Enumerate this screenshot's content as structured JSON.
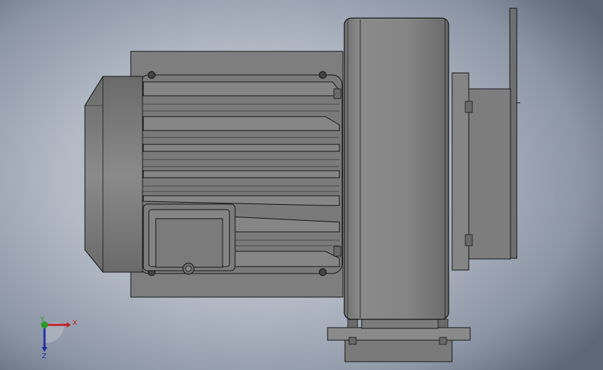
{
  "colors": {
    "background_center": "#c9ced8",
    "background_edge": "#5e6778",
    "part_shade": "#7a7a7a",
    "part_light": "#8c8c8c",
    "edge_line": "#111111",
    "x_axis": "#c0202a",
    "y_axis": "#2a9a2a",
    "z_axis": "#1f2fa8"
  },
  "triad": {
    "x_label": "X",
    "y_label": "Y",
    "z_label": "Z",
    "icon": "coordinate-triad-icon"
  }
}
